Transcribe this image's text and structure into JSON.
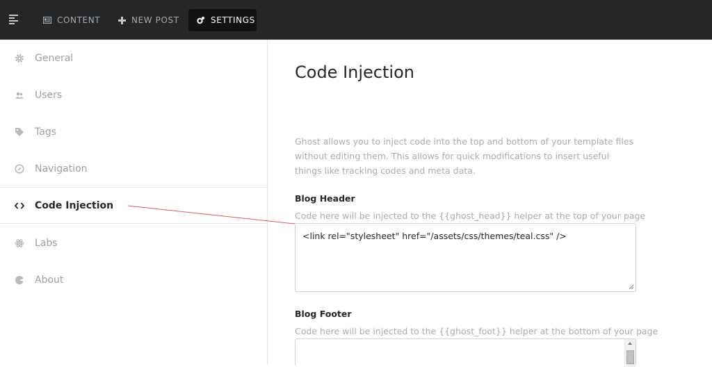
{
  "topnav": {
    "content_label": "CONTENT",
    "new_post_label": "NEW POST",
    "settings_label": "SETTINGS"
  },
  "sidebar": {
    "items": [
      {
        "label": "General",
        "icon": "gear-icon"
      },
      {
        "label": "Users",
        "icon": "users-icon"
      },
      {
        "label": "Tags",
        "icon": "tag-icon"
      },
      {
        "label": "Navigation",
        "icon": "compass-icon"
      },
      {
        "label": "Code Injection",
        "icon": "code-icon",
        "active": true
      },
      {
        "label": "Labs",
        "icon": "atom-icon"
      },
      {
        "label": "About",
        "icon": "ghost-icon"
      }
    ]
  },
  "main": {
    "title": "Code Injection",
    "intro": "Ghost allows you to inject code into the top and bottom of your template files without editing them. This allows for quick modifications to insert useful things like tracking codes and meta data.",
    "header": {
      "label": "Blog Header",
      "help": "Code here will be injected to the {{ghost_head}} helper at the top of your page",
      "value": "<link rel=\"stylesheet\" href=\"/assets/css/themes/teal.css\" />"
    },
    "footer": {
      "label": "Blog Footer",
      "help": "Code here will be injected to the {{ghost_foot}} helper at the bottom of your page",
      "value": ""
    }
  },
  "colors": {
    "topbar": "#242628",
    "annotation_line": "#e05a5a"
  }
}
